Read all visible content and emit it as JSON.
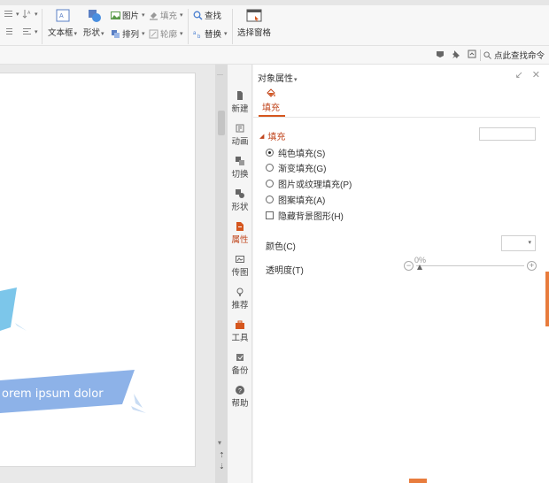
{
  "ribbon": {
    "textbox_label": "文本框",
    "shape_label": "形状",
    "picture_label": "图片",
    "fill_label": "填充",
    "arrange_label": "排列",
    "outline_label": "轮廓",
    "find_label": "查找",
    "replace_label": "替换",
    "selection_pane_label": "选择窗格"
  },
  "search": {
    "placeholder": "点此查找命令"
  },
  "slide": {
    "text": "orem ipsum dolor"
  },
  "nav": {
    "items": [
      {
        "label": "新建",
        "icon": "new-doc-icon"
      },
      {
        "label": "动画",
        "icon": "animation-icon"
      },
      {
        "label": "切换",
        "icon": "switch-icon"
      },
      {
        "label": "形状",
        "icon": "shape-icon"
      },
      {
        "label": "属性",
        "icon": "property-icon"
      },
      {
        "label": "传图",
        "icon": "upload-image-icon"
      },
      {
        "label": "推荐",
        "icon": "recommend-icon"
      },
      {
        "label": "工具",
        "icon": "toolbox-icon"
      },
      {
        "label": "备份",
        "icon": "backup-icon"
      },
      {
        "label": "帮助",
        "icon": "help-icon"
      }
    ]
  },
  "pane": {
    "title": "对象属性",
    "tab_fill": "填充",
    "section_title": "填充",
    "options": [
      "纯色填充(S)",
      "渐变填充(G)",
      "图片或纹理填充(P)",
      "图案填充(A)"
    ],
    "selected_option": "纯色填充(S)",
    "hide_bg_label": "隐藏背景图形(H)",
    "color_label": "颜色(C)",
    "transparency_label": "透明度(T)",
    "transparency_value": "0%"
  },
  "colors": {
    "accent": "#c0451c",
    "slide_blue": "#8db2e8",
    "slide_cyan": "#7cc6ea",
    "edge_orange": "#e87c3d"
  }
}
